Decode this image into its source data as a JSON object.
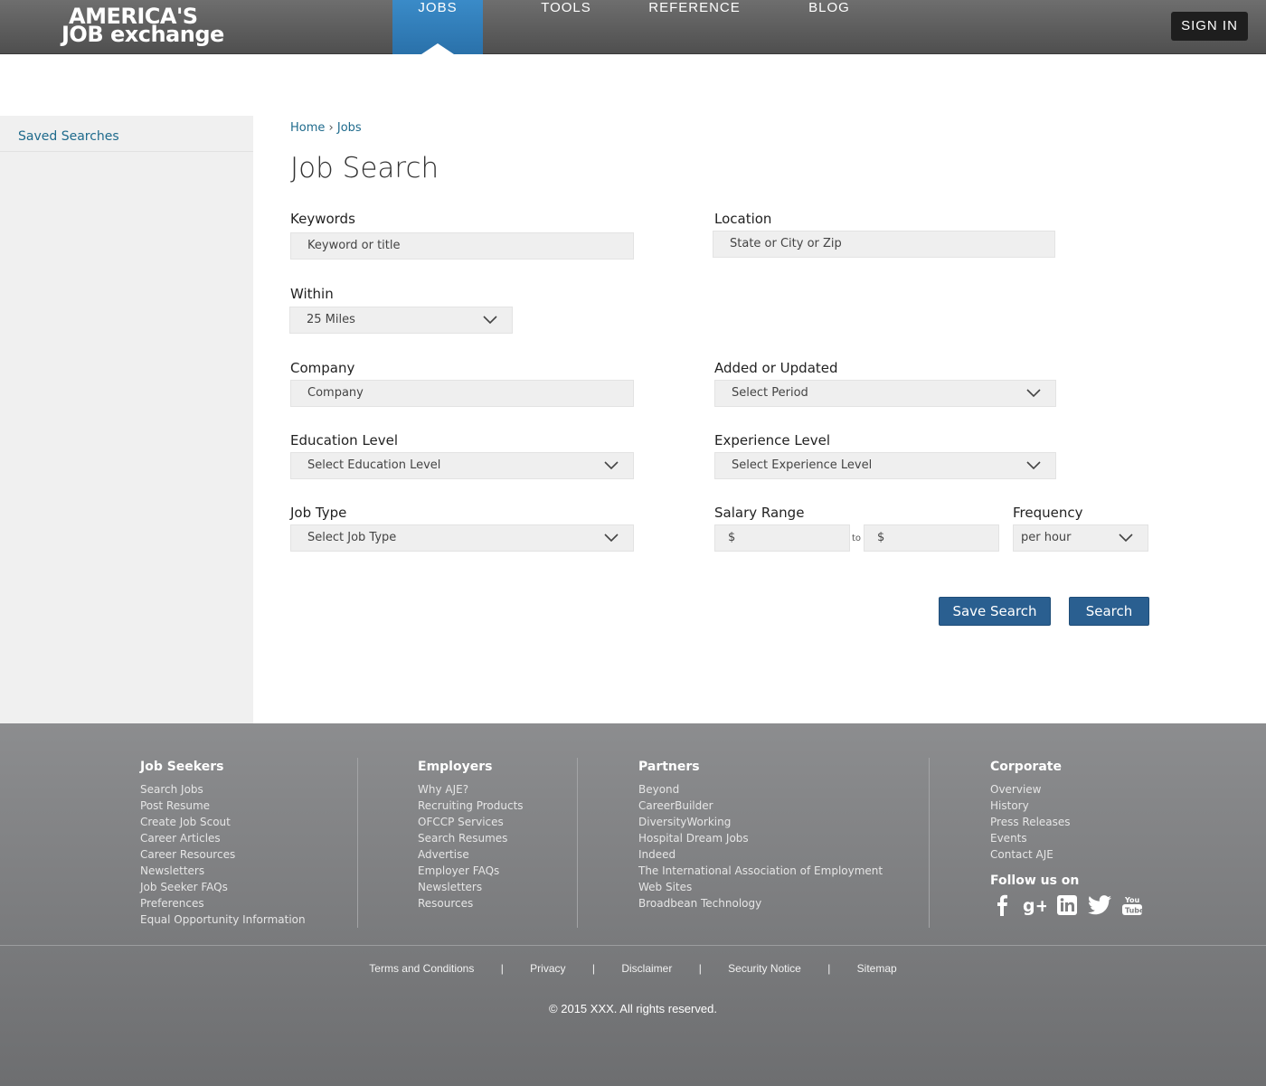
{
  "header": {
    "logo_line1": "AMERICA'S",
    "logo_line2": "JOB exchange",
    "nav": [
      {
        "label": "JOBS"
      },
      {
        "label": "TOOLS"
      },
      {
        "label": "REFERENCE"
      },
      {
        "label": "BLOG"
      }
    ],
    "signin": "SIGN IN",
    "colors": {
      "active_tab": "#2f7fbf",
      "bar": "#5e5e5e"
    }
  },
  "sidebar": {
    "items": [
      {
        "label": "Saved Searches"
      }
    ]
  },
  "breadcrumb": {
    "home": "Home",
    "sep": "›",
    "current": "Jobs"
  },
  "page_title": "Job Search",
  "form": {
    "keywords": {
      "label": "Keywords",
      "placeholder": "Keyword or title"
    },
    "location": {
      "label": "Location",
      "placeholder": "State or City or Zip"
    },
    "within": {
      "label": "Within",
      "value": "25 Miles"
    },
    "company": {
      "label": "Company",
      "placeholder": "Company"
    },
    "added": {
      "label": "Added or Updated",
      "value": "Select Period"
    },
    "education": {
      "label": "Education Level",
      "value": "Select Education Level"
    },
    "experience": {
      "label": "Experience Level",
      "value": "Select Experience Level"
    },
    "job_type": {
      "label": "Job Type",
      "value": "Select Job Type"
    },
    "salary": {
      "label": "Salary Range",
      "from": "$",
      "to_label": "to",
      "to": "$"
    },
    "frequency": {
      "label": "Frequency",
      "value": "per hour"
    },
    "save_button": "Save Search",
    "search_button": "Search"
  },
  "footer": {
    "job_seekers": {
      "title": "Job Seekers",
      "links": [
        "Search Jobs",
        "Post Resume",
        "Create Job Scout",
        "Career Articles",
        "Career Resources",
        "Newsletters",
        "Job Seeker FAQs",
        "Preferences",
        "Equal Opportunity Information"
      ]
    },
    "employers": {
      "title": "Employers",
      "links": [
        "Why AJE?",
        "Recruiting Products",
        "OFCCP Services",
        "Search Resumes",
        "Advertise",
        "Employer FAQs",
        "Newsletters",
        "Resources"
      ]
    },
    "partners": {
      "title": "Partners",
      "links": [
        "Beyond",
        "CareerBuilder",
        "DiversityWorking",
        "Hospital Dream Jobs",
        "Indeed",
        "The International Association of Employment",
        "Web Sites",
        "Broadbean Technology"
      ]
    },
    "corporate": {
      "title": "Corporate",
      "links": [
        "Overview",
        "History",
        "Press Releases",
        "Events",
        "Contact AJE"
      ]
    },
    "follow": "Follow us on",
    "socials": [
      "facebook-icon",
      "google-plus-icon",
      "linkedin-icon",
      "twitter-icon",
      "youtube-icon"
    ],
    "legal": [
      "Terms and Conditions",
      "Privacy",
      "Disclaimer",
      "Security Notice",
      "Sitemap"
    ],
    "legal_sep": "|",
    "copyright": "© 2015 XXX. All rights reserved."
  }
}
